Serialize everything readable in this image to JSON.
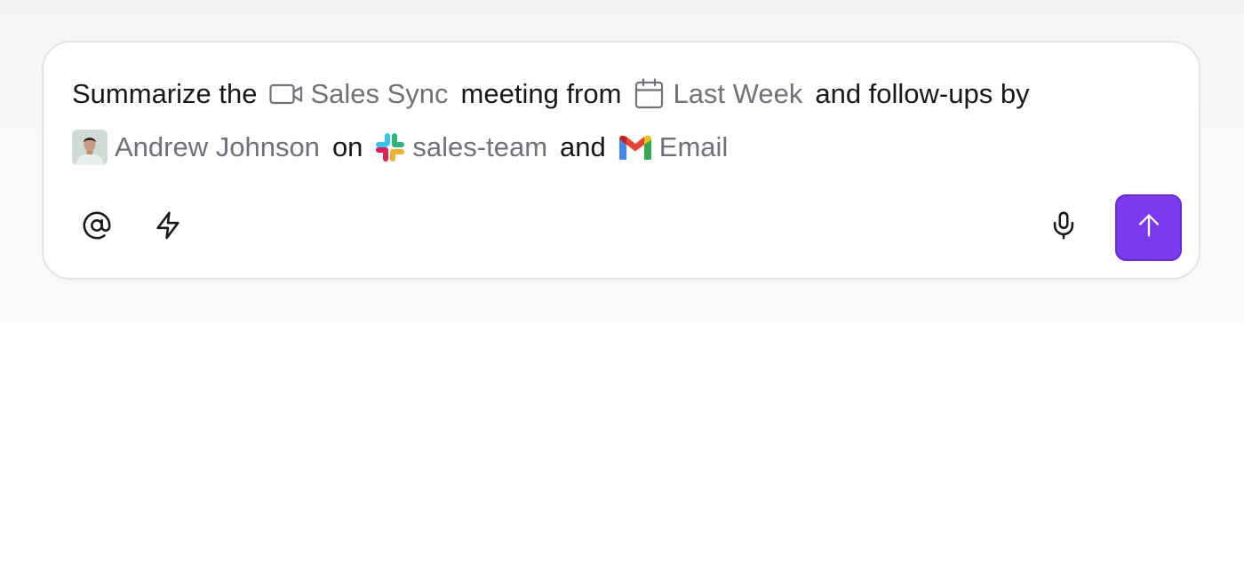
{
  "composer": {
    "line1": {
      "t1": "Summarize the",
      "meeting_label": "Sales Sync",
      "t2": "meeting from",
      "date_label": "Last Week",
      "t3": "and follow-ups by"
    },
    "line2": {
      "person_label": "Andrew Johnson",
      "t4": "on",
      "channel_label": "sales-team",
      "t5": "and",
      "email_label": "Email"
    }
  },
  "toolbar": {
    "mention_icon": "at-sign-icon",
    "shortcut_icon": "lightning-bolt-icon",
    "voice_icon": "microphone-icon",
    "send_icon": "arrow-up-icon"
  },
  "colors": {
    "text": "#18181b",
    "mention_text": "#71717a",
    "send_button": "#7c3aed",
    "border": "#e4e4e7"
  }
}
